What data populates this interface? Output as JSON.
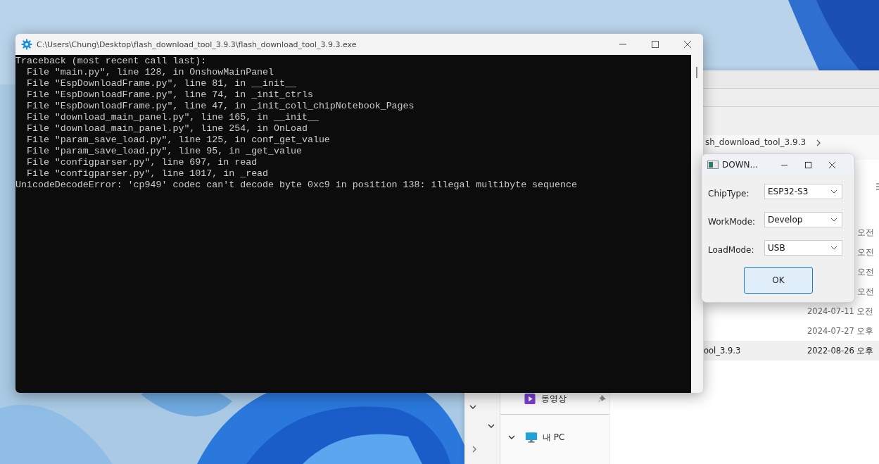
{
  "console_window": {
    "title": "C:\\Users\\Chung\\Desktop\\flash_download_tool_3.9.3\\flash_download_tool_3.9.3.exe",
    "lines": [
      "Traceback (most recent call last):",
      "  File \"main.py\", line 128, in OnshowMainPanel",
      "  File \"EspDownloadFrame.py\", line 81, in __init__",
      "  File \"EspDownloadFrame.py\", line 74, in _init_ctrls",
      "  File \"EspDownloadFrame.py\", line 47, in _init_coll_chipNotebook_Pages",
      "  File \"download_main_panel.py\", line 165, in __init__",
      "  File \"download_main_panel.py\", line 254, in OnLoad",
      "  File \"param_save_load.py\", line 125, in conf_get_value",
      "  File \"param_save_load.py\", line 95, in _get_value",
      "  File \"configparser.py\", line 697, in read",
      "  File \"configparser.py\", line 1017, in _read",
      "UnicodeDecodeError: 'cp949' codec can't decode byte 0xc9 in position 138: illegal multibyte sequence"
    ]
  },
  "explorer": {
    "breadcrumb": "sh_download_tool_3.9.3",
    "files": [
      {
        "modified": "오전",
        "selected": false
      },
      {
        "modified": "오전",
        "selected": false
      },
      {
        "modified": "오전",
        "selected": false
      },
      {
        "modified": "오전",
        "selected": false
      },
      {
        "modified": "2024-07-11 오전",
        "selected": false
      },
      {
        "modified": "2024-07-27 오후",
        "selected": false
      },
      {
        "name": "ool_3.9.3",
        "modified": "2022-08-26 오후",
        "selected": true
      }
    ],
    "sidebar": [
      {
        "label": "동영상",
        "kind": "videos"
      },
      {
        "label": "내 PC",
        "kind": "pc"
      }
    ]
  },
  "dialog": {
    "title": "DOWN...",
    "fields": [
      {
        "label": "ChipType:",
        "value": "ESP32-S3"
      },
      {
        "label": "WorkMode:",
        "value": "Develop"
      },
      {
        "label": "LoadMode:",
        "value": "USB"
      }
    ],
    "ok_button": "OK"
  }
}
